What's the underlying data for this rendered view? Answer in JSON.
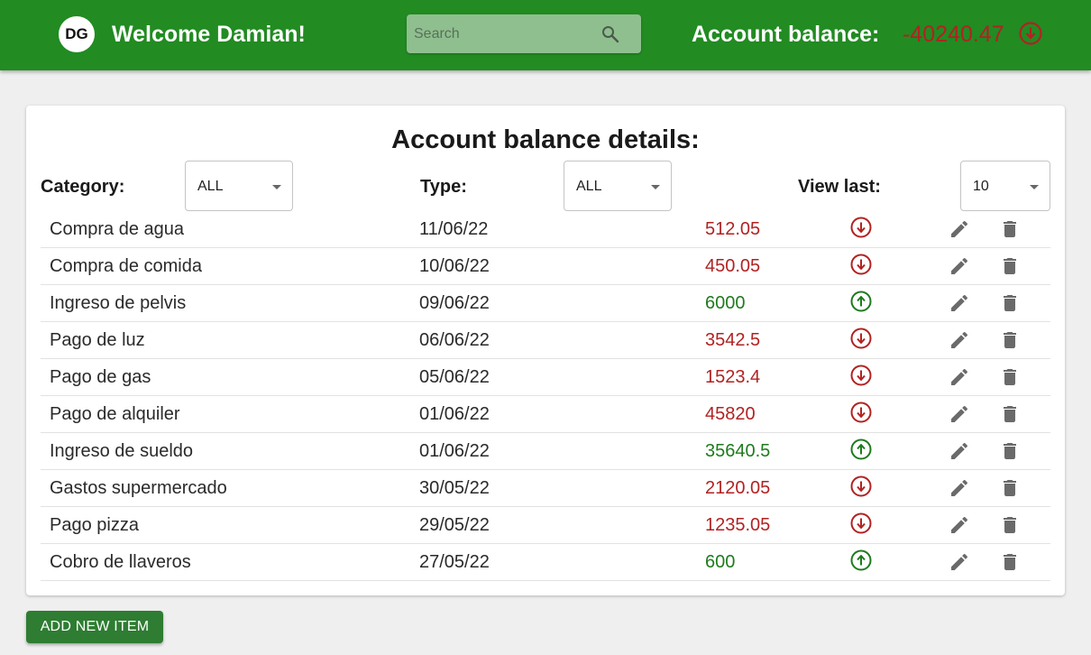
{
  "header": {
    "avatar_initials": "DG",
    "welcome": "Welcome Damian!",
    "search_placeholder": "Search",
    "balance_label": "Account balance:",
    "balance_value": "-40240.47",
    "balance_direction": "down-arrow-circle-icon",
    "bar_color": "#228b22"
  },
  "details": {
    "title": "Account balance details:",
    "filters": {
      "category_label": "Category:",
      "category_value": "ALL",
      "type_label": "Type:",
      "type_value": "ALL",
      "view_last_label": "View last:",
      "view_last_value": "10"
    },
    "rows": [
      {
        "name": "Compra de agua",
        "date": "11/06/22",
        "amount": "512.05",
        "direction": "out"
      },
      {
        "name": "Compra de comida",
        "date": "10/06/22",
        "amount": "450.05",
        "direction": "out"
      },
      {
        "name": "Ingreso de pelvis",
        "date": "09/06/22",
        "amount": "6000",
        "direction": "in"
      },
      {
        "name": "Pago de luz",
        "date": "06/06/22",
        "amount": "3542.5",
        "direction": "out"
      },
      {
        "name": "Pago de gas",
        "date": "05/06/22",
        "amount": "1523.4",
        "direction": "out"
      },
      {
        "name": "Pago de alquiler",
        "date": "01/06/22",
        "amount": "45820",
        "direction": "out"
      },
      {
        "name": "Ingreso de sueldo",
        "date": "01/06/22",
        "amount": "35640.5",
        "direction": "in"
      },
      {
        "name": "Gastos supermercado",
        "date": "30/05/22",
        "amount": "2120.05",
        "direction": "out"
      },
      {
        "name": "Pago pizza",
        "date": "29/05/22",
        "amount": "1235.05",
        "direction": "out"
      },
      {
        "name": "Cobro de llaveros",
        "date": "27/05/22",
        "amount": "600",
        "direction": "in"
      }
    ]
  },
  "actions": {
    "add_new_label": "ADD NEW ITEM"
  },
  "colors": {
    "outgoing": "#b22222",
    "incoming": "#1e7b1e",
    "button": "#2e7d32"
  }
}
